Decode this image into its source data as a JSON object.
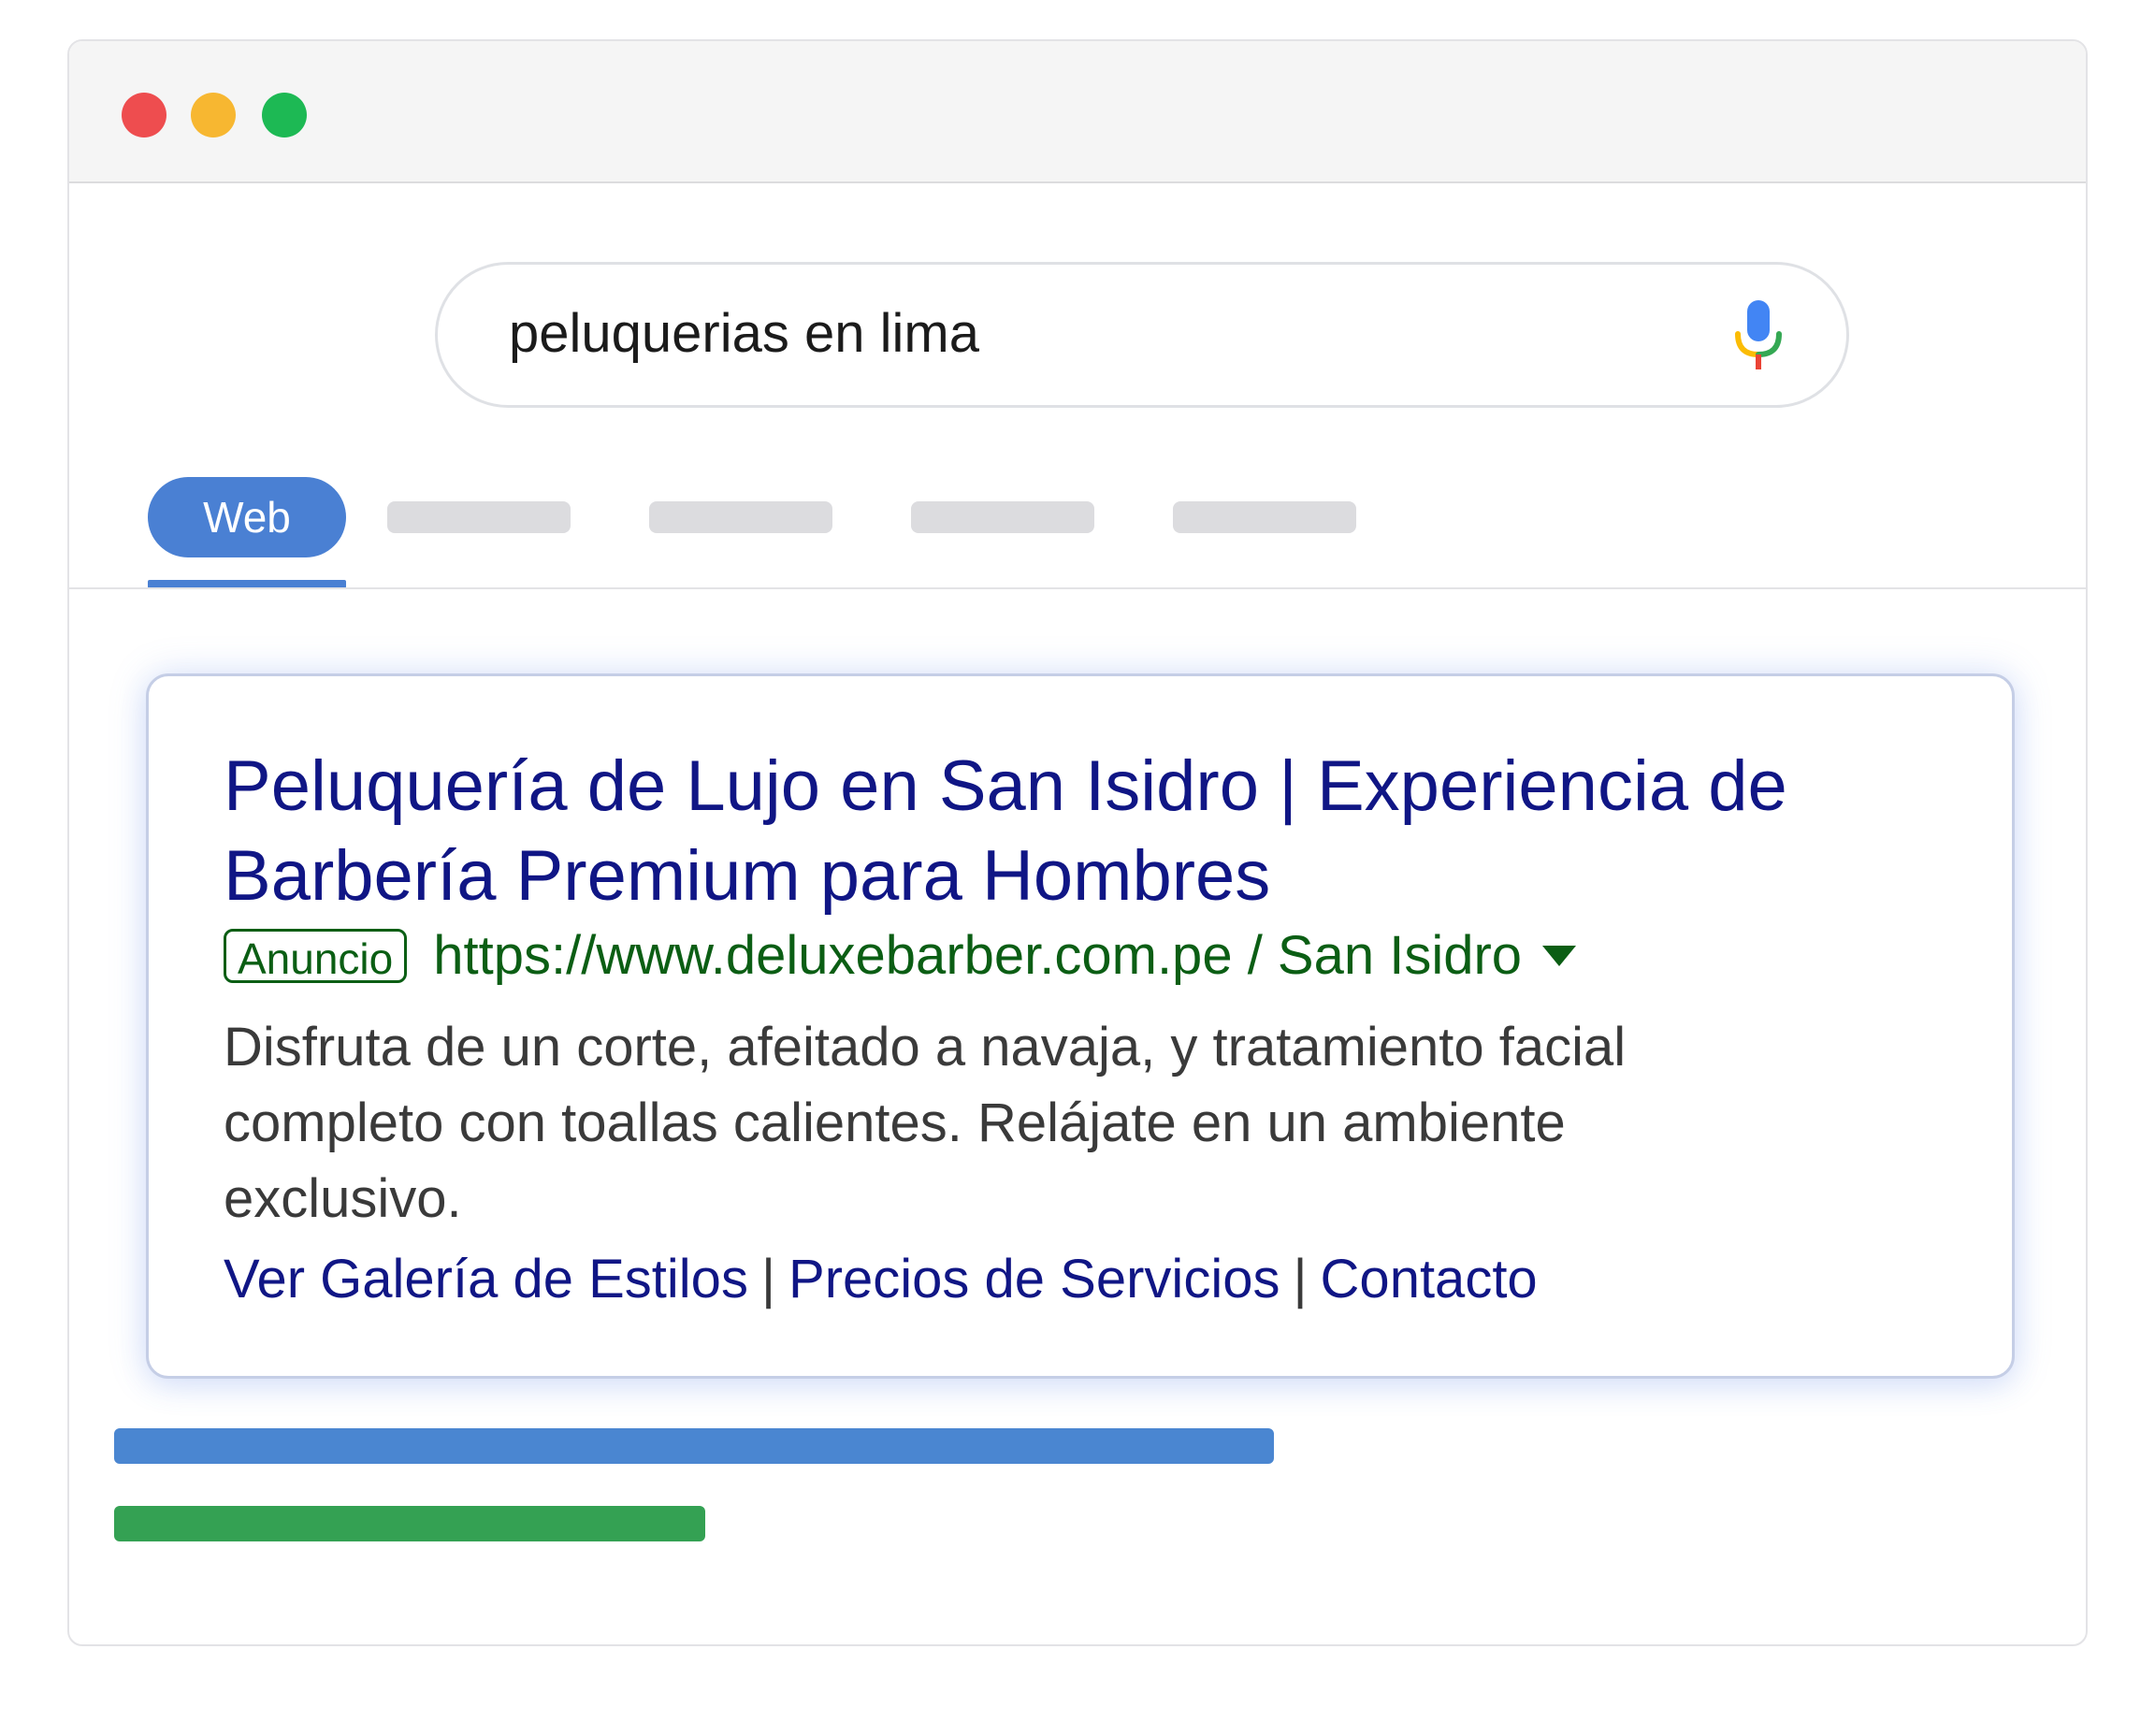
{
  "window": {
    "controls": [
      "close",
      "minimize",
      "maximize"
    ],
    "colors": {
      "close": "#ee4d4f",
      "minimize": "#f7b731",
      "maximize": "#1db954"
    }
  },
  "search": {
    "query": "peluquerias en lima",
    "mic_icon": "microphone-icon"
  },
  "tabs": {
    "active_label": "Web",
    "placeholder_count": 4,
    "accent": "#4a80d3"
  },
  "ad": {
    "title": "Peluquería de Lujo en San Isidro | Experiencia de Barbería Premium para Hombres",
    "badge": "Anuncio",
    "url": "https://www.deluxebarber.com.pe / San Isidro",
    "description": "Disfruta de un corte, afeitado a navaja, y tratamiento facial completo con toallas calientes. Relájate en un ambiente exclusivo.",
    "sitelinks": [
      "Ver Galería de Estilos",
      "Precios de Servicios",
      "Contacto"
    ],
    "separator": "|",
    "colors": {
      "title": "#101685",
      "url": "#0b5e14",
      "text": "#3a3a3a"
    }
  },
  "results_placeholder": {
    "colors": {
      "title_bar": "#4a86d1",
      "url_bar": "#34a153"
    }
  }
}
